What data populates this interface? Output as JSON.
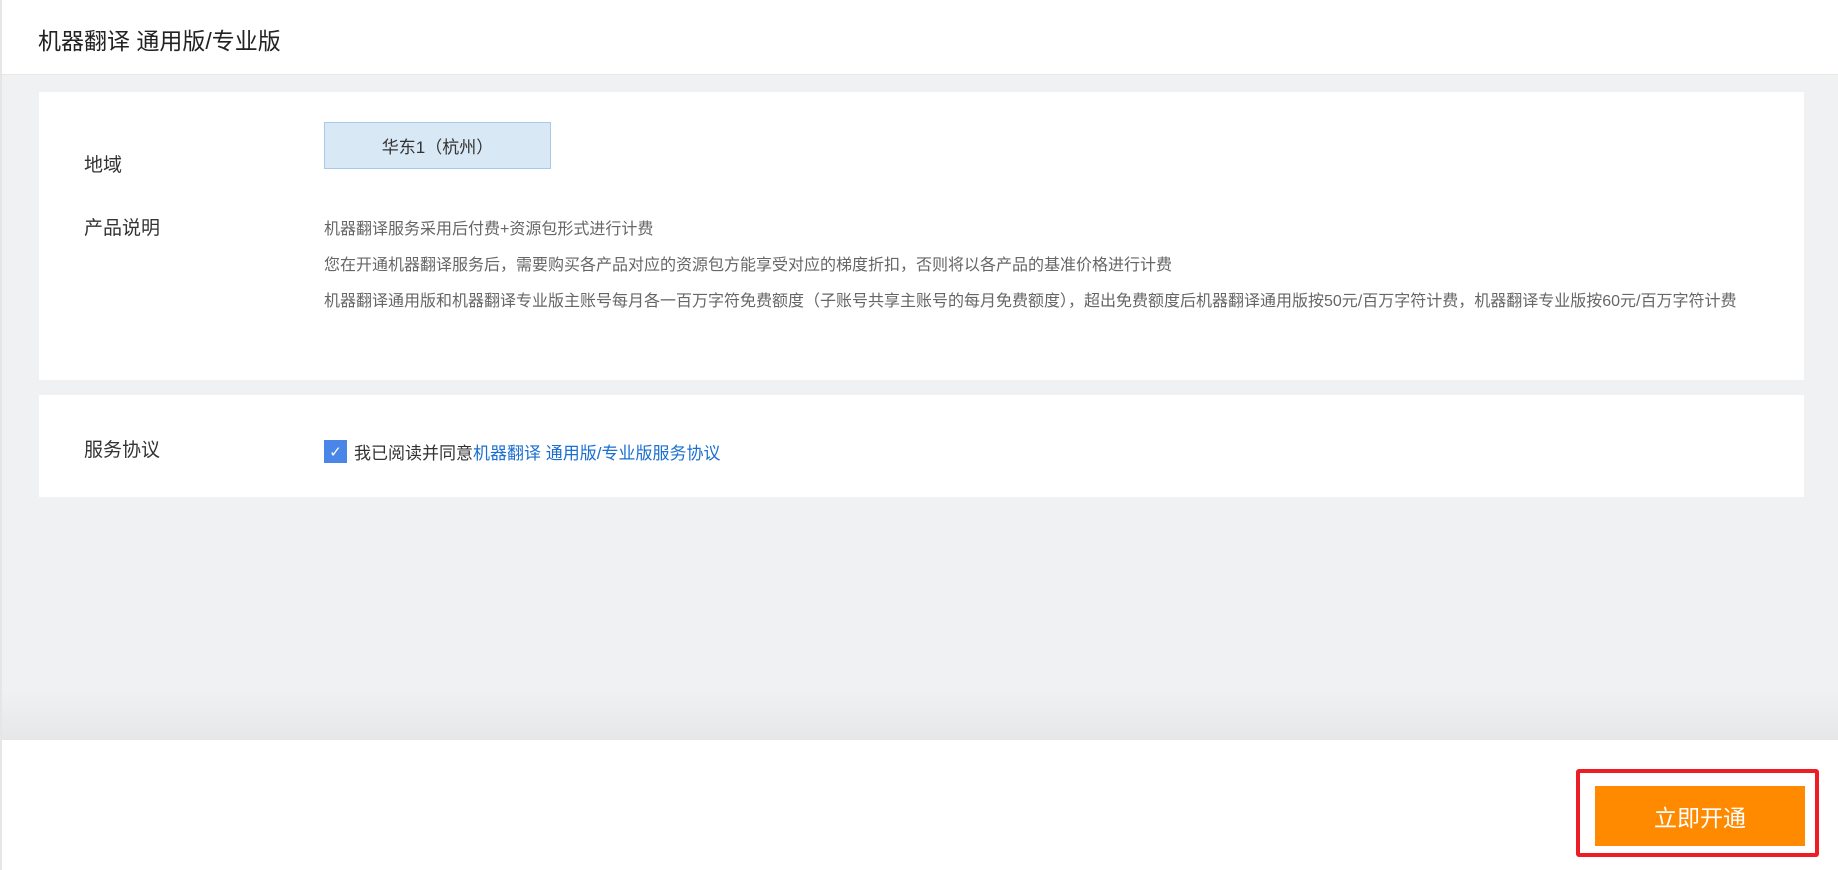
{
  "header": {
    "title": "机器翻译 通用版/专业版"
  },
  "region": {
    "label": "地域",
    "value": "华东1（杭州）"
  },
  "product": {
    "label": "产品说明",
    "lines": [
      "机器翻译服务采用后付费+资源包形式进行计费",
      "您在开通机器翻译服务后，需要购买各产品对应的资源包方能享受对应的梯度折扣，否则将以各产品的基准价格进行计费",
      "机器翻译通用版和机器翻译专业版主账号每月各一百万字符免费额度（子账号共享主账号的每月免费额度），超出免费额度后机器翻译通用版按50元/百万字符计费，机器翻译专业版按60元/百万字符计费"
    ]
  },
  "agreement": {
    "label": "服务协议",
    "checked": true,
    "text": "我已阅读并同意",
    "link": "机器翻译 通用版/专业版服务协议"
  },
  "footer": {
    "activate_label": "立即开通"
  },
  "colors": {
    "accent": "#ff8a00",
    "link": "#1a6fd0",
    "highlight": "#ee1c25"
  }
}
